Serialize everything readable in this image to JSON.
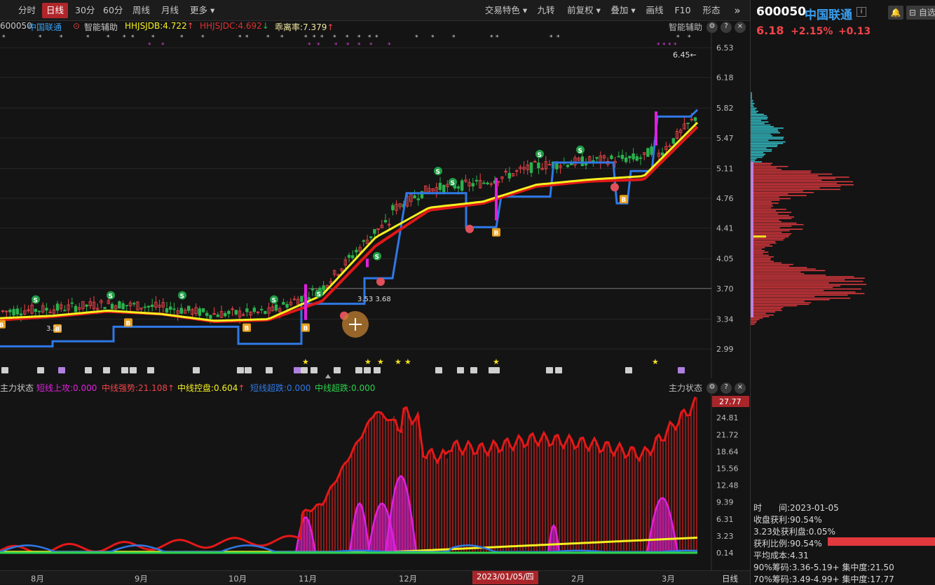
{
  "toolbar": {
    "tabs": [
      "分时",
      "日线",
      "30分",
      "60分",
      "周线",
      "月线",
      "更多"
    ],
    "active": "日线",
    "right": [
      "交易特色",
      "九转",
      "前复权",
      "叠加",
      "画线",
      "F10",
      "形态"
    ]
  },
  "main_legend": {
    "code": "600050",
    "name": "中国联通",
    "assist": "智能辅助",
    "db": "HHJSJDB:4.722",
    "dc": "HHJSJDC:4.692",
    "bias": "乖离率:7.379",
    "right_label": "智能辅助"
  },
  "sub_legend": {
    "title": "主力状态",
    "s1": "短线上攻:0.000",
    "s2": "中线强势:21.108",
    "s3": "中线控盘:0.604",
    "s4": "短线超跌:0.000",
    "s5": "中线超跌:0.000",
    "right_label": "主力状态"
  },
  "price_axis": [
    "6.53",
    "6.18",
    "5.82",
    "5.47",
    "5.11",
    "4.76",
    "4.41",
    "4.05",
    "3.70",
    "3.34",
    "2.99"
  ],
  "indicator_axis": [
    "27.77",
    "24.81",
    "21.72",
    "18.64",
    "15.56",
    "12.48",
    "9.39",
    "6.31",
    "3.23",
    "0.14"
  ],
  "annotations": {
    "high_label": "6.45",
    "low_label": "3.23",
    "mid_label": "3.53 3.68"
  },
  "time_axis": [
    "8月",
    "9月",
    "10月",
    "11月",
    "12月",
    "2月",
    "3月"
  ],
  "time_cursor": "2023/01/05/四",
  "period_label": "日线",
  "sidebar": {
    "code": "600050",
    "name": "中国联通",
    "price": "6.18",
    "pct": "+2.15%",
    "chg": "+0.13",
    "button": "自选",
    "time": "时　　间:2023-01-05",
    "profit": "收盘获利:90.54%",
    "profit_at": "3.23处获利盘:0.05%",
    "ratio": "获利比例:90.54%",
    "avg_cost": "平均成本:4.31",
    "chip90": "90%筹码:3.36-5.19+ 集中度:21.50",
    "chip70": "70%筹码:3.49-4.99+ 集中度:17.77"
  },
  "chart_data": {
    "type": "line",
    "title": "600050 中国联通 日线",
    "x_labels": [
      "8月",
      "9月",
      "10月",
      "11月",
      "12月",
      "2023/01/05",
      "2月",
      "3月"
    ],
    "price_range": [
      2.99,
      6.53
    ],
    "series": [
      {
        "name": "HHJSJDB",
        "values": [
          3.35,
          3.38,
          3.44,
          3.4,
          3.32,
          3.34,
          3.62,
          4.3,
          4.65,
          4.72,
          4.92,
          4.98,
          5.02,
          5.65
        ]
      },
      {
        "name": "HHJSJDC",
        "values": [
          3.33,
          3.37,
          3.43,
          3.4,
          3.31,
          3.33,
          3.55,
          4.2,
          4.62,
          4.7,
          4.9,
          4.96,
          4.98,
          5.6
        ]
      },
      {
        "name": "主力状态-中线强势",
        "values": [
          0.5,
          1.0,
          2.0,
          2.5,
          3.0,
          4.5,
          9.0,
          26.0,
          20.0,
          19.0,
          21.0,
          20.0,
          18.0,
          27.77
        ]
      }
    ],
    "indicator_range": [
      0.14,
      27.77
    ],
    "colors": {
      "up": "#f0444a",
      "down": "#2bb24c",
      "ma1": "#f5f020",
      "ma2": "#e01818",
      "trend": "#2f78e6",
      "accent": "#e020e0"
    }
  }
}
